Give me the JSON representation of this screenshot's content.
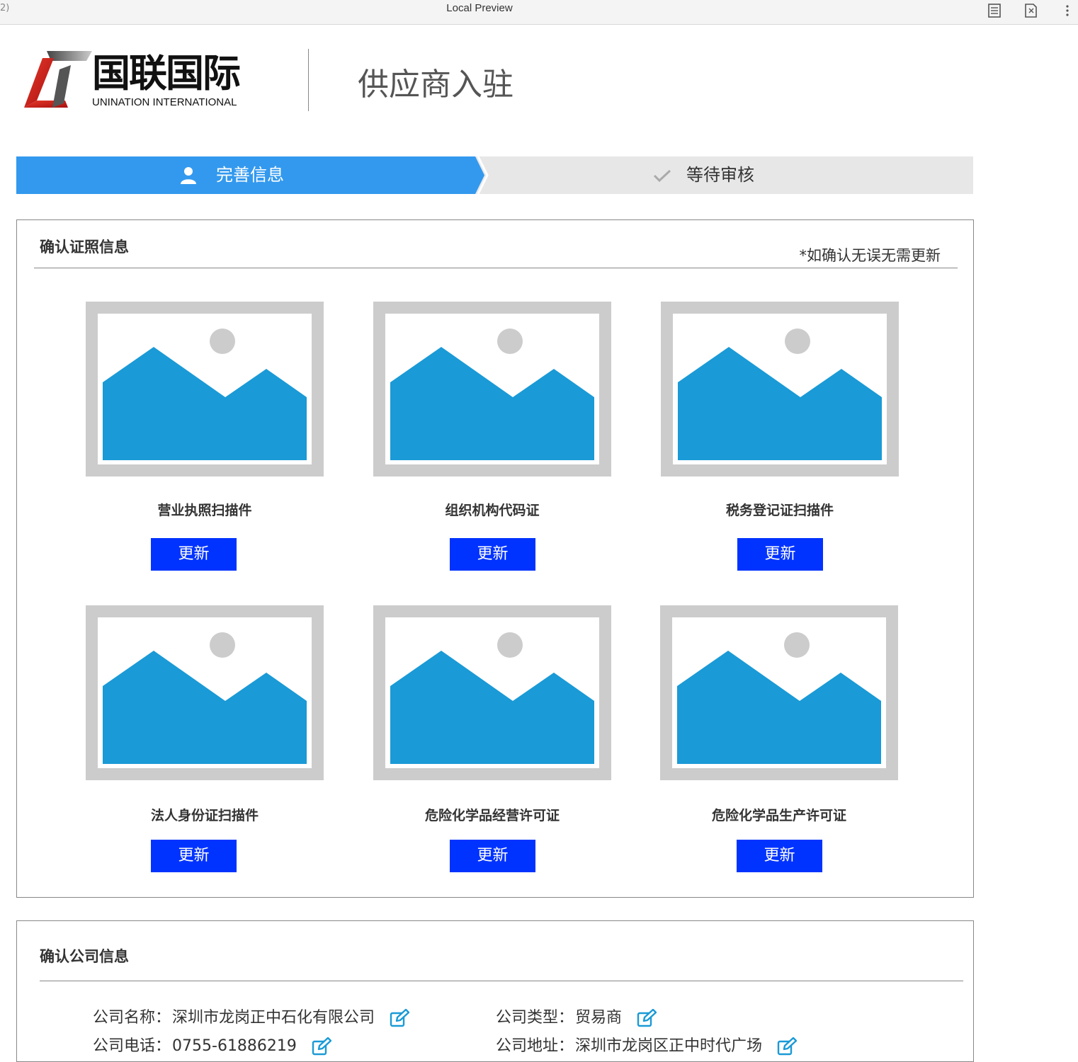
{
  "preview_bar": {
    "left_fragment": "2)",
    "title": "Local Preview"
  },
  "logo": {
    "cn": "国联国际",
    "en": "UNINATION INTERNATIONAL"
  },
  "page_title": "供应商入驻",
  "steps": [
    {
      "label": "完善信息",
      "state": "active"
    },
    {
      "label": "等待审核",
      "state": "pending"
    }
  ],
  "licenses": {
    "title": "确认证照信息",
    "note": "*如确认无误无需更新",
    "items": [
      {
        "label": "营业执照扫描件",
        "button": "更新"
      },
      {
        "label": "组织机构代码证",
        "button": "更新"
      },
      {
        "label": "税务登记证扫描件",
        "button": "更新"
      },
      {
        "label": "法人身份证扫描件",
        "button": "更新"
      },
      {
        "label": "危险化学品经营许可证",
        "button": "更新"
      },
      {
        "label": "危险化学品生产许可证",
        "button": "更新"
      }
    ]
  },
  "company": {
    "title": "确认公司信息",
    "fields": [
      {
        "label": "公司名称：",
        "value": "深圳市龙岗正中石化有限公司"
      },
      {
        "label": "公司类型：",
        "value": "贸易商"
      },
      {
        "label": "公司电话：",
        "value": "0755-61886219"
      },
      {
        "label": "公司地址：",
        "value": "深圳市龙岗区正中时代广场"
      }
    ]
  },
  "colors": {
    "accent": "#3399ee",
    "button": "#0033ff",
    "image_fill": "#1a9ad6"
  }
}
